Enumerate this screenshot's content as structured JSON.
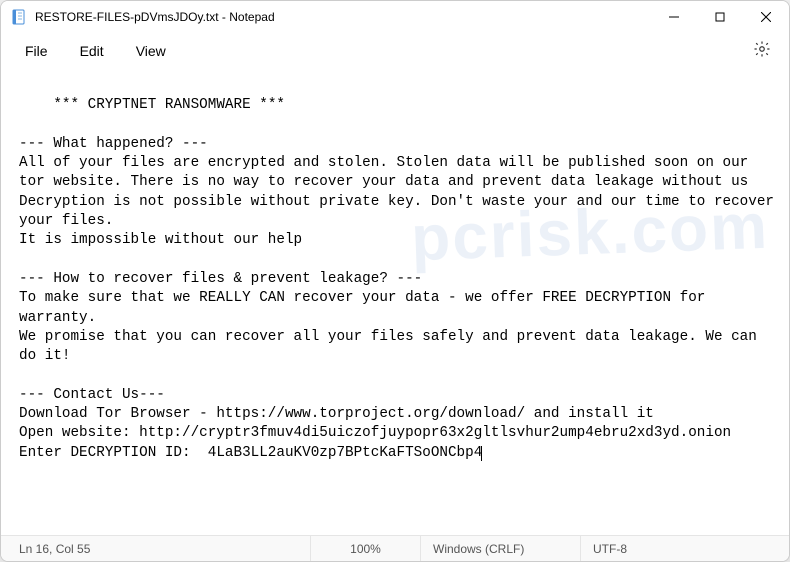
{
  "titlebar": {
    "title": "RESTORE-FILES-pDVmsJDOy.txt - Notepad"
  },
  "menu": {
    "file": "File",
    "edit": "Edit",
    "view": "View"
  },
  "document": {
    "body": "*** CRYPTNET RANSOMWARE ***\n\n--- What happened? ---\nAll of your files are encrypted and stolen. Stolen data will be published soon on our tor website. There is no way to recover your data and prevent data leakage without us\nDecryption is not possible without private key. Don't waste your and our time to recover your files.\nIt is impossible without our help\n\n--- How to recover files & prevent leakage? ---\nTo make sure that we REALLY CAN recover your data - we offer FREE DECRYPTION for warranty.\nWe promise that you can recover all your files safely and prevent data leakage. We can do it!\n\n--- Contact Us---\nDownload Tor Browser - https://www.torproject.org/download/ and install it\nOpen website: http://cryptr3fmuv4di5uiczofjuypopr63x2gltlsvhur2ump4ebru2xd3yd.onion\nEnter DECRYPTION ID:  4LaB3LL2auKV0zp7BPtcKaFTSoONCbp4"
  },
  "statusbar": {
    "position": "Ln 16, Col 55",
    "zoom": "100%",
    "line_ending": "Windows (CRLF)",
    "encoding": "UTF-8"
  },
  "watermark": "pcrisk.com"
}
